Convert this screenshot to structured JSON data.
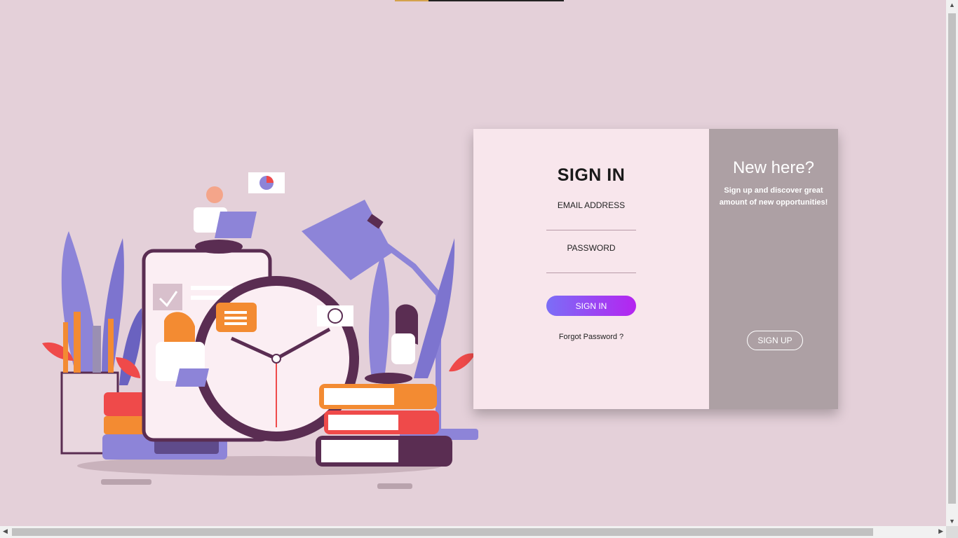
{
  "signin": {
    "title": "SIGN IN",
    "email_label": "EMAIL ADDRESS",
    "email_value": "",
    "password_label": "PASSWORD",
    "password_value": "",
    "button_label": "SIGN IN",
    "forgot_label": "Forgot Password ?"
  },
  "signup_panel": {
    "title": "New here?",
    "subtitle": "Sign up and discover great amount of new opportunities!",
    "button_label": "SIGN UP"
  },
  "colors": {
    "page_bg": "#e4d0d9",
    "card_left_bg": "#f8e6ec",
    "card_right_bg": "#ada0a4",
    "button_gradient_start": "#7b6ef6",
    "button_gradient_end": "#b524f0"
  },
  "icons": {
    "illustration": "people-working-with-clock-books-plants-illustration",
    "scroll_up": "arrow-up-icon",
    "scroll_down": "arrow-down-icon",
    "scroll_left": "arrow-left-icon",
    "scroll_right": "arrow-right-icon"
  }
}
